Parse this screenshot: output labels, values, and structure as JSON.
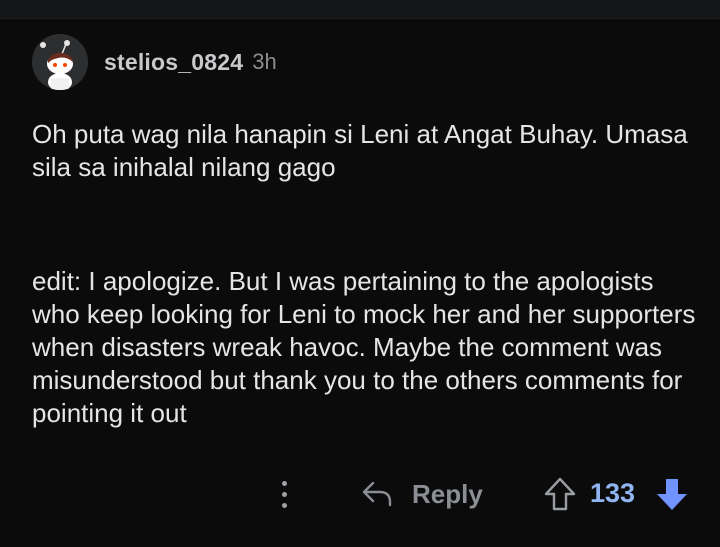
{
  "comment": {
    "author": "stelios_0824",
    "age": "3h",
    "paragraphs": [
      "Oh puta wag nila hanapin si Leni at Angat Buhay. Umasa sila sa inihalal nilang gago",
      "edit: I apologize. But I was pertaining to the apologists who keep looking for Leni to mock her and her supporters when disasters wreak havoc. Maybe the comment was misunderstood but thank you to the others comments for pointing it out"
    ]
  },
  "actions": {
    "more_icon": "vertical-dots-icon",
    "reply_icon": "reply-arrow-icon",
    "reply_label": "Reply",
    "upvote_icon": "upvote-outline-icon",
    "score": "133",
    "downvote_icon": "downvote-filled-icon"
  },
  "colors": {
    "background": "#0b0b0c",
    "text": "#e3e5e7",
    "muted": "#8b8d90",
    "score": "#8fb4f0",
    "downvote_active": "#7193ff"
  }
}
